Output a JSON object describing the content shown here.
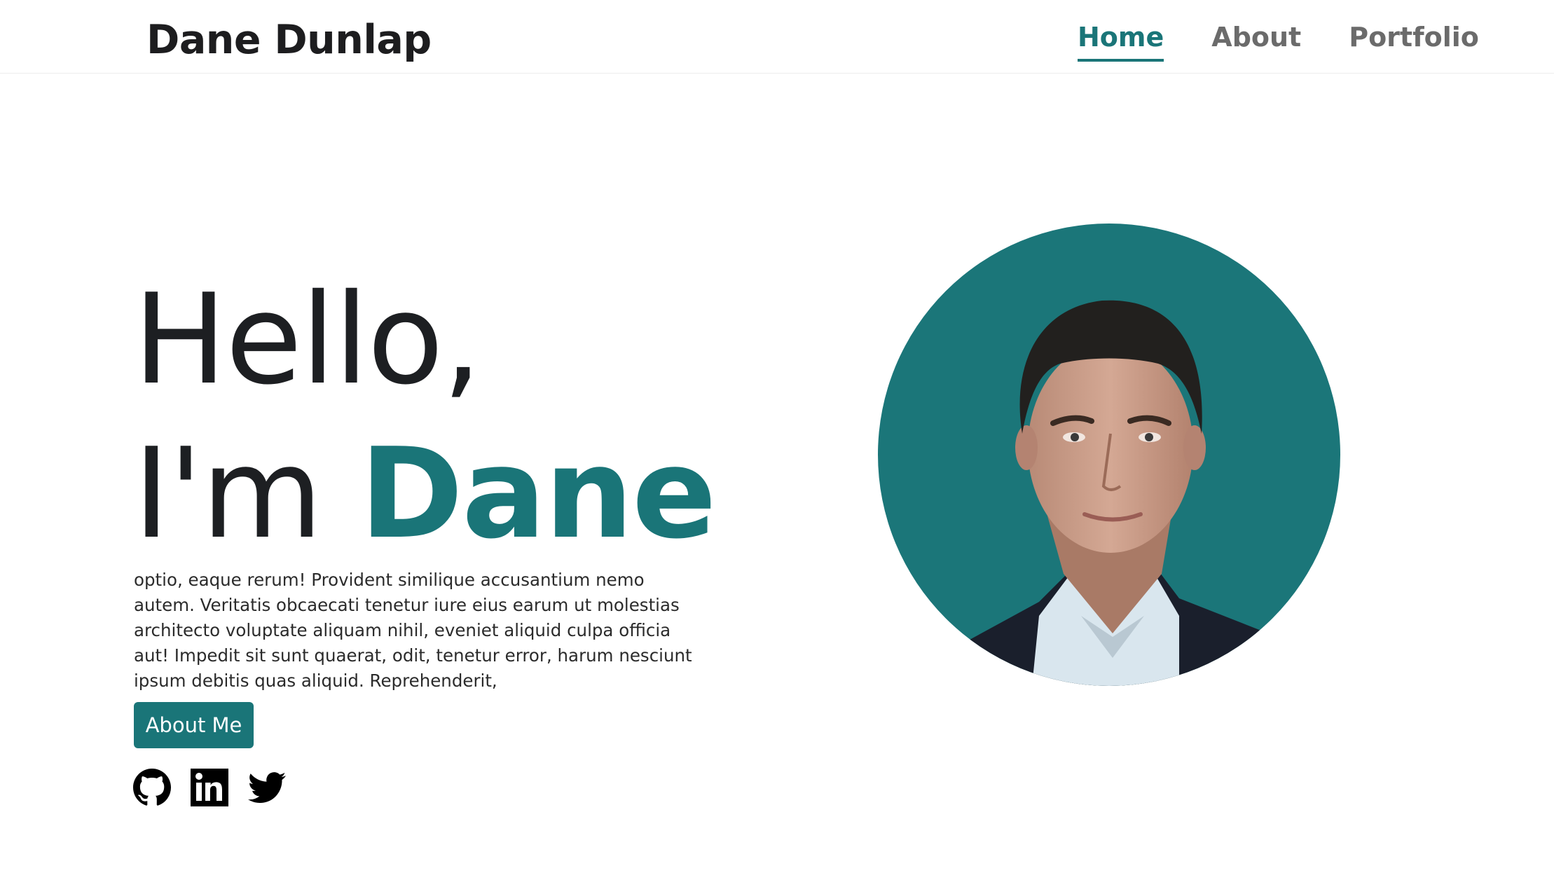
{
  "nav": {
    "brand": "Dane Dunlap",
    "links": [
      {
        "label": "Home",
        "active": true
      },
      {
        "label": "About",
        "active": false
      },
      {
        "label": "Portfolio",
        "active": false
      }
    ]
  },
  "hero": {
    "line1": "Hello,",
    "line2_prefix": "I'm",
    "line2_name": "Dane",
    "description": "optio, eaque rerum! Provident similique accusantium nemo autem. Veritatis obcaecati tenetur iure eius earum ut molestias architecto voluptate aliquam nihil, eveniet aliquid culpa officia aut! Impedit sit sunt quaerat, odit, tenetur error, harum nesciunt ipsum debitis quas aliquid. Reprehenderit,",
    "button_label": "About Me"
  },
  "socials": [
    {
      "icon": "github-icon"
    },
    {
      "icon": "linkedin-icon"
    },
    {
      "icon": "twitter-icon"
    }
  ],
  "colors": {
    "accent": "#1a7578",
    "text_dark": "#1d1f22",
    "nav_inactive": "#6b6b6b"
  }
}
